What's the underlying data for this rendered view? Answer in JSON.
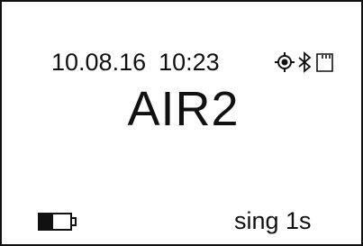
{
  "status": {
    "date": "10.08.16",
    "time": "10:23",
    "icons": [
      "gps-target-icon",
      "bluetooth-icon",
      "sd-card-icon"
    ]
  },
  "mode": {
    "name": "AIR2"
  },
  "footer": {
    "battery_icon": "battery-low-icon",
    "measurement_mode": "sing 1s"
  }
}
